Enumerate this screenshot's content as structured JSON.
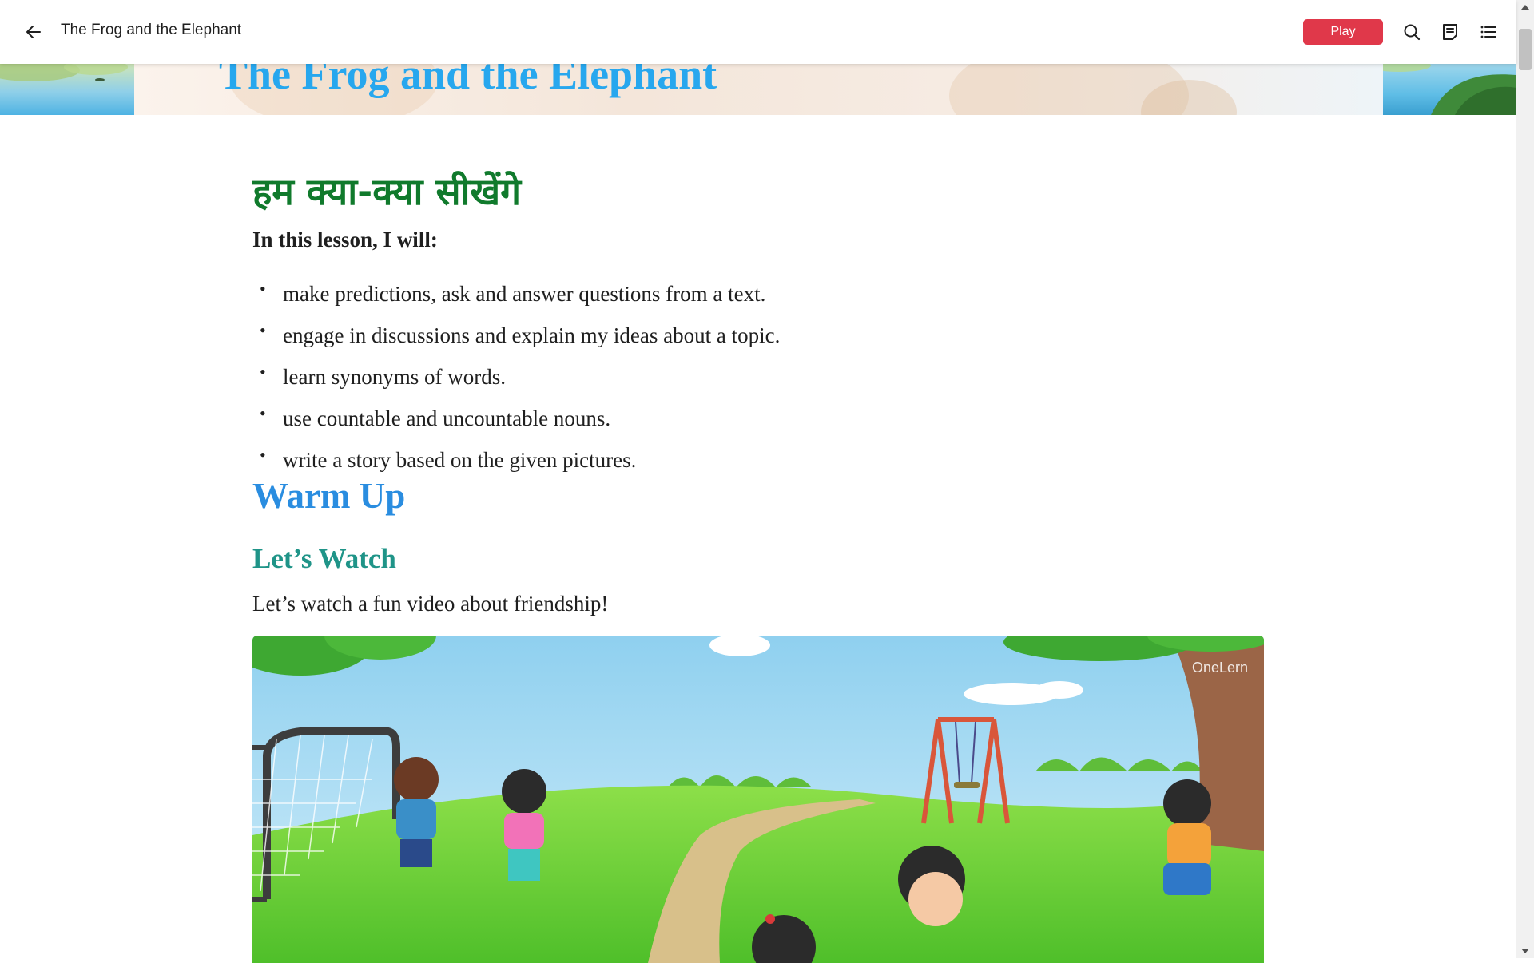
{
  "app": {
    "title": "The Frog and the Elephant",
    "play_label": "Play"
  },
  "banner": {
    "title": "The Frog and the Elephant"
  },
  "lesson": {
    "hindi_heading": "हम क्या-क्या सीखेंगे",
    "intro": "In this lesson, I will:",
    "objectives": [
      "make predictions, ask and answer questions from a text.",
      "engage in discussions and explain my ideas about a topic.",
      "learn synonyms of words.",
      "use countable and uncountable nouns.",
      "write a story based on the given pictures."
    ],
    "bullet": "•"
  },
  "warmup": {
    "heading": "Warm Up",
    "subheading": "Let’s Watch",
    "text": "Let’s watch a fun video about friendship!",
    "video_watermark": "OneLern"
  },
  "colors": {
    "play_button": "#e0384a",
    "hindi_heading": "#107a2c",
    "warmup_heading": "#2a8de0",
    "letswatch_heading": "#1f9488",
    "banner_title": "#27a7ee"
  },
  "icons": [
    "arrow-left-icon",
    "search-icon",
    "notes-icon",
    "list-icon"
  ]
}
